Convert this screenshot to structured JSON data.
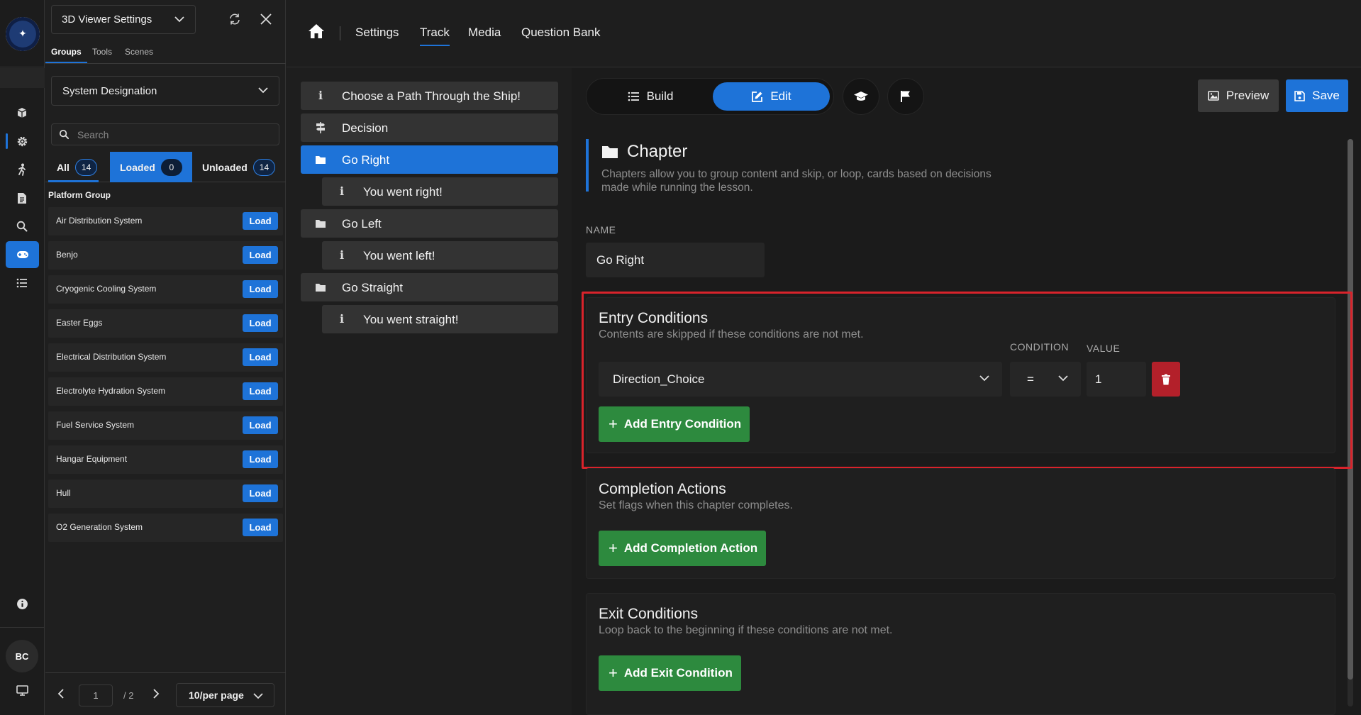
{
  "rail": {
    "avatar": "BC",
    "icons": [
      "cube-icon",
      "gear-icon",
      "walking-person-icon",
      "document-icon",
      "search-icon",
      "gamepad-icon",
      "list-icon",
      "info-icon",
      "monitor-icon"
    ]
  },
  "panel": {
    "viewer_select": "3D Viewer Settings",
    "subtabs": [
      "Groups",
      "Tools",
      "Scenes"
    ],
    "designation": "System Designation",
    "search_placeholder": "Search",
    "filters": {
      "all_label": "All",
      "all_count": "14",
      "loaded_label": "Loaded",
      "loaded_count": "0",
      "unloaded_label": "Unloaded",
      "unloaded_count": "14"
    },
    "group_title": "Platform Group",
    "load_label": "Load",
    "items": [
      "Air Distribution System",
      "Benjo",
      "Cryogenic Cooling System",
      "Easter Eggs",
      "Electrical Distribution System",
      "Electrolyte Hydration System",
      "Fuel Service System",
      "Hangar Equipment",
      "Hull",
      "O2 Generation System"
    ],
    "pager": {
      "page": "1",
      "total": "/ 2",
      "per_page": "10/per page"
    }
  },
  "nav": {
    "links": [
      "Settings",
      "Track",
      "Media",
      "Question Bank"
    ],
    "active": "Track"
  },
  "track": [
    {
      "icon": "info-icon",
      "label": "Choose a Path Through the Ship!",
      "indent": false,
      "active": false
    },
    {
      "icon": "signpost-icon",
      "label": "Decision",
      "indent": false,
      "active": false
    },
    {
      "icon": "folder-icon",
      "label": "Go Right",
      "indent": false,
      "active": true
    },
    {
      "icon": "info-icon",
      "label": "You went right!",
      "indent": true,
      "active": false
    },
    {
      "icon": "folder-icon",
      "label": "Go Left",
      "indent": false,
      "active": false
    },
    {
      "icon": "info-icon",
      "label": "You went left!",
      "indent": true,
      "active": false
    },
    {
      "icon": "folder-icon",
      "label": "Go Straight",
      "indent": false,
      "active": false
    },
    {
      "icon": "info-icon",
      "label": "You went straight!",
      "indent": true,
      "active": false
    }
  ],
  "editor": {
    "mode_build": "Build",
    "mode_edit": "Edit",
    "preview": "Preview",
    "save": "Save",
    "chapter_title": "Chapter",
    "chapter_desc": "Chapters allow you to group content and skip, or loop, cards based on decisions made while running the lesson.",
    "name_label": "NAME",
    "name_value": "Go Right",
    "entry": {
      "title": "Entry Conditions",
      "subtitle": "Contents are skipped if these conditions are not met.",
      "condition_label": "CONDITION",
      "value_label": "VALUE",
      "variable": "Direction_Choice",
      "operator": "=",
      "value": "1",
      "add": "Add Entry Condition"
    },
    "completion": {
      "title": "Completion Actions",
      "subtitle": "Set flags when this chapter completes.",
      "add": "Add Completion Action"
    },
    "exit": {
      "title": "Exit Conditions",
      "subtitle": "Loop back to the beginning if these conditions are not met.",
      "add": "Add Exit Condition"
    },
    "colors": {
      "accent": "#1e73d8",
      "green": "#2d8a3e",
      "danger": "#b3202a",
      "highlight": "#d9232b"
    }
  }
}
